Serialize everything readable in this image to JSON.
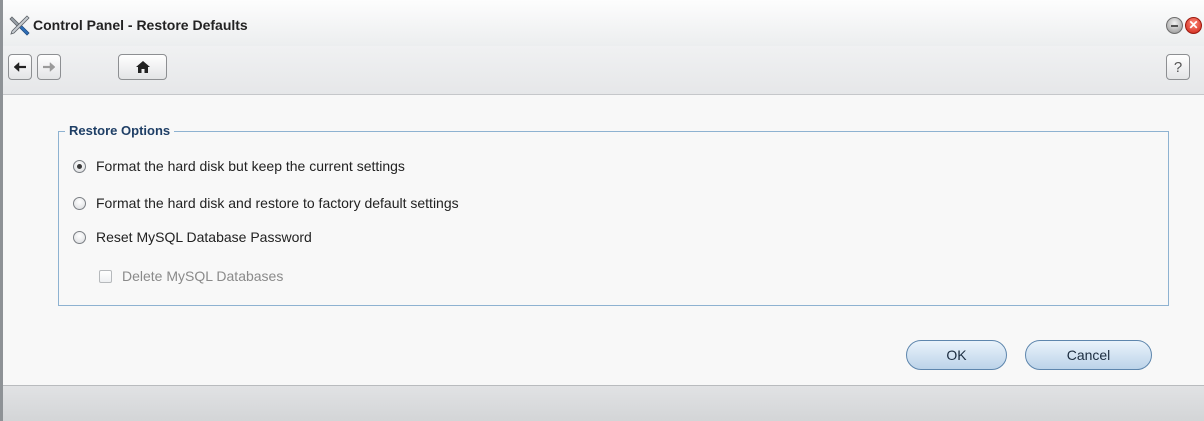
{
  "window": {
    "title": "Control Panel - Restore Defaults",
    "icon": "control-panel-tools-icon",
    "close_glyph": "✕"
  },
  "toolbar": {
    "back_icon": "arrow-left-icon",
    "forward_icon": "arrow-right-icon",
    "home_icon": "home-icon",
    "help_label": "?"
  },
  "restore_options": {
    "legend": "Restore Options",
    "options": [
      {
        "label": "Format the hard disk but keep the current settings",
        "checked": true
      },
      {
        "label": "Format the hard disk and restore to factory default settings",
        "checked": false
      },
      {
        "label": "Reset MySQL Database Password",
        "checked": false
      }
    ],
    "sub_option": {
      "label": "Delete MySQL Databases",
      "checked": false,
      "disabled": true
    }
  },
  "actions": {
    "ok_label": "OK",
    "cancel_label": "Cancel"
  },
  "colors": {
    "accent_border": "#8eb2d1",
    "legend_text": "#1f3f66",
    "button_fill": "#bcd3e9",
    "close_button": "#cc1f11"
  }
}
